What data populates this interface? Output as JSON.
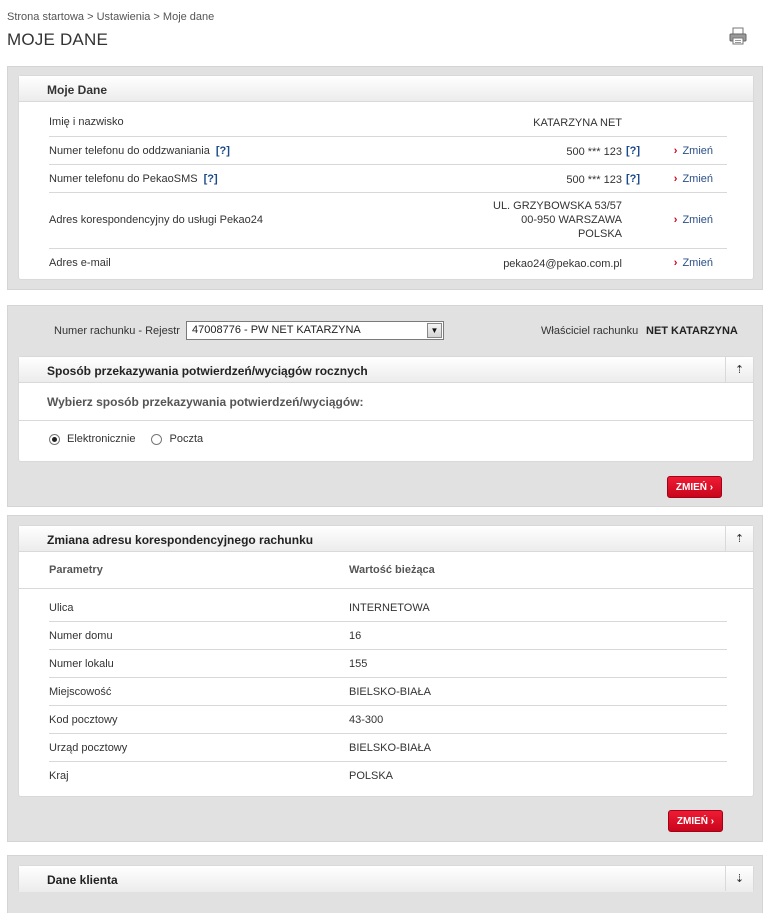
{
  "breadcrumb": "Strona startowa > Ustawienia > Moje dane",
  "page_title": "MOJE DANE",
  "icons": {
    "print": "printer-icon",
    "collapse_up": "arrow-up-icon",
    "expand_down": "arrow-down-icon",
    "change": "chevron-right-icon"
  },
  "colors": {
    "accent_red": "#d0021b",
    "link_blue": "#2b4f87",
    "panel_bg": "#e1e1e1"
  },
  "my_data": {
    "title": "Moje Dane",
    "rows": [
      {
        "label": "Imię i nazwisko",
        "value": "KATARZYNA NET"
      },
      {
        "label": "Numer telefonu do oddzwaniania",
        "help": "[?]",
        "value": "500 *** 123",
        "value_help": "[?]",
        "action": "Zmień"
      },
      {
        "label": "Numer telefonu do PekaoSMS",
        "help": "[?]",
        "value": "500 *** 123",
        "value_help": "[?]",
        "action": "Zmień"
      },
      {
        "label": "Adres korespondencyjny do usługi Pekao24",
        "value_lines": [
          "UL. GRZYBOWSKA 53/57",
          "00-950 WARSZAWA",
          "POLSKA"
        ],
        "action": "Zmień"
      },
      {
        "label": "Adres e-mail",
        "value": "pekao24@pekao.com.pl",
        "action": "Zmień"
      }
    ]
  },
  "account": {
    "label": "Numer rachunku - Rejestr",
    "selected": "47008776 - PW NET KATARZYNA",
    "owner_label": "Właściciel rachunku",
    "owner_value": "NET KATARZYNA"
  },
  "delivery": {
    "title": "Sposób przekazywania potwierdzeń/wyciągów rocznych",
    "subtitle": "Wybierz sposób przekazywania potwierdzeń/wyciągów:",
    "options": [
      "Elektronicznie",
      "Poczta"
    ],
    "selected": "Elektronicznie",
    "button": "ZMIEŃ ›"
  },
  "address_change": {
    "title": "Zmiana adresu korespondencyjnego rachunku",
    "col_param": "Parametry",
    "col_value": "Wartość bieżąca",
    "rows": [
      {
        "param": "Ulica",
        "value": "INTERNETOWA"
      },
      {
        "param": "Numer domu",
        "value": "16"
      },
      {
        "param": "Numer lokalu",
        "value": "155"
      },
      {
        "param": "Miejscowość",
        "value": "BIELSKO-BIAŁA"
      },
      {
        "param": "Kod pocztowy",
        "value": "43-300"
      },
      {
        "param": "Urząd pocztowy",
        "value": "BIELSKO-BIAŁA"
      },
      {
        "param": "Kraj",
        "value": "POLSKA"
      }
    ],
    "button": "ZMIEŃ ›"
  },
  "client_data": {
    "title": "Dane klienta"
  }
}
